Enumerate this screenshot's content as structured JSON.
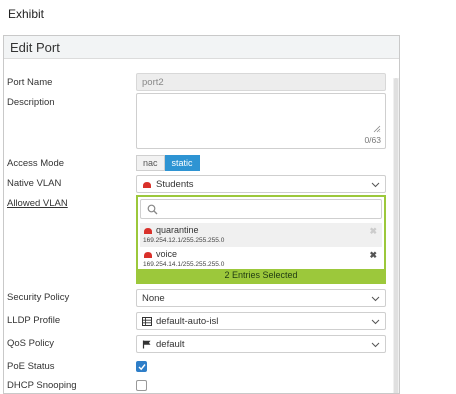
{
  "exhibit_label": "Exhibit",
  "dialog": {
    "title": "Edit Port",
    "labels": {
      "port_name": "Port Name",
      "description": "Description",
      "access_mode": "Access Mode",
      "native_vlan": "Native VLAN",
      "allowed_vlan": "Allowed VLAN",
      "security_policy": "Security Policy",
      "lldp_profile": "LLDP Profile",
      "qos_policy": "QoS Policy",
      "poe_status": "PoE Status",
      "dhcp_snooping": "DHCP Snooping"
    },
    "port_name_value": "port2",
    "description_value": "",
    "description_counter": "0/63",
    "access_mode": {
      "options": [
        "nac",
        "static"
      ],
      "selected": "static"
    },
    "native_vlan": "Students",
    "allowed_vlan": {
      "search_value": "",
      "entries": [
        {
          "name": "quarantine",
          "address": "169.254.12.1/255.255.255.0"
        },
        {
          "name": "voice",
          "address": "169.254.14.1/255.255.255.0"
        }
      ],
      "selected_summary": "2 Entries Selected"
    },
    "security_policy": "None",
    "lldp_profile": "default-auto-isl",
    "qos_policy": "default",
    "poe_status": true,
    "dhcp_snooping": false,
    "colors": {
      "accent_green": "#9cc83b",
      "toggle_blue": "#2e94d3",
      "icon_red": "#d9302a"
    },
    "icons": {
      "vlan_icon": "red-interface-icon",
      "lldp_icon": "table-icon",
      "qos_icon": "flag-icon",
      "dropdown": "chevron-down-icon",
      "search": "search-icon",
      "remove": "close-icon"
    }
  }
}
